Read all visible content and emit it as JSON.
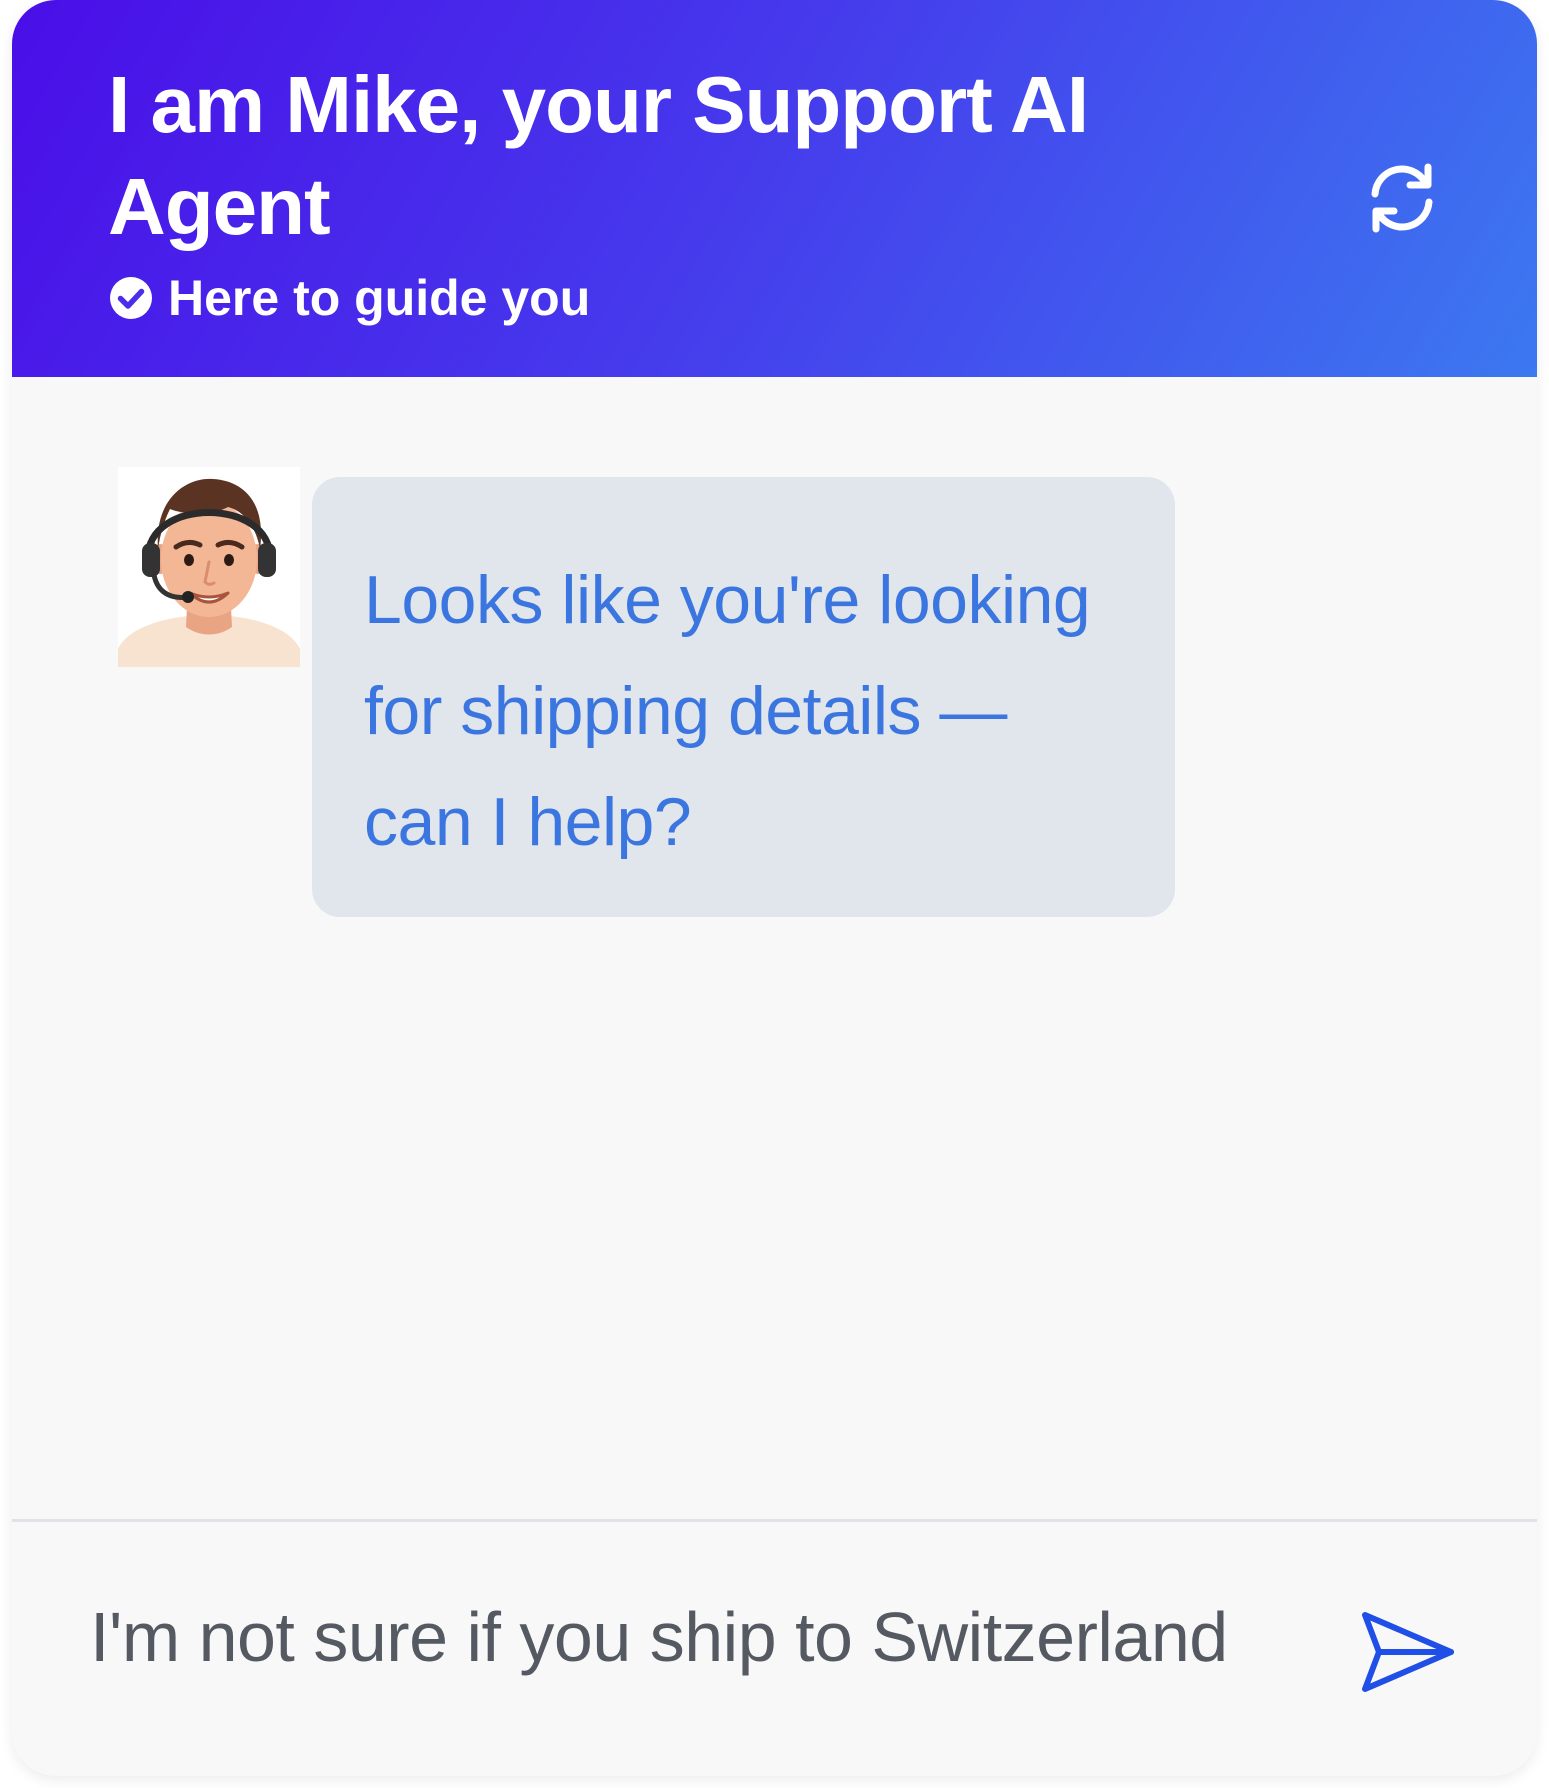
{
  "header": {
    "title": "I am Mike, your Support AI Agent",
    "subtitle": "Here to guide you",
    "subtitle_icon": "check-circle-icon",
    "action_icon": "refresh-icon",
    "gradient_colors": [
      "#4a0ee8",
      "#3c78f0"
    ]
  },
  "messages": [
    {
      "sender": "agent",
      "avatar_icon": "support-agent-avatar",
      "text": "Looks like you're looking for shipping details — can I help?"
    }
  ],
  "composer": {
    "value": "I'm not sure if you ship to Switzerland",
    "send_icon": "send-icon"
  },
  "colors": {
    "accent": "#3b76e0",
    "bubble_bg": "#e1e5ec",
    "panel_bg": "#f8f8f8",
    "send_icon": "#1f4fe6"
  }
}
